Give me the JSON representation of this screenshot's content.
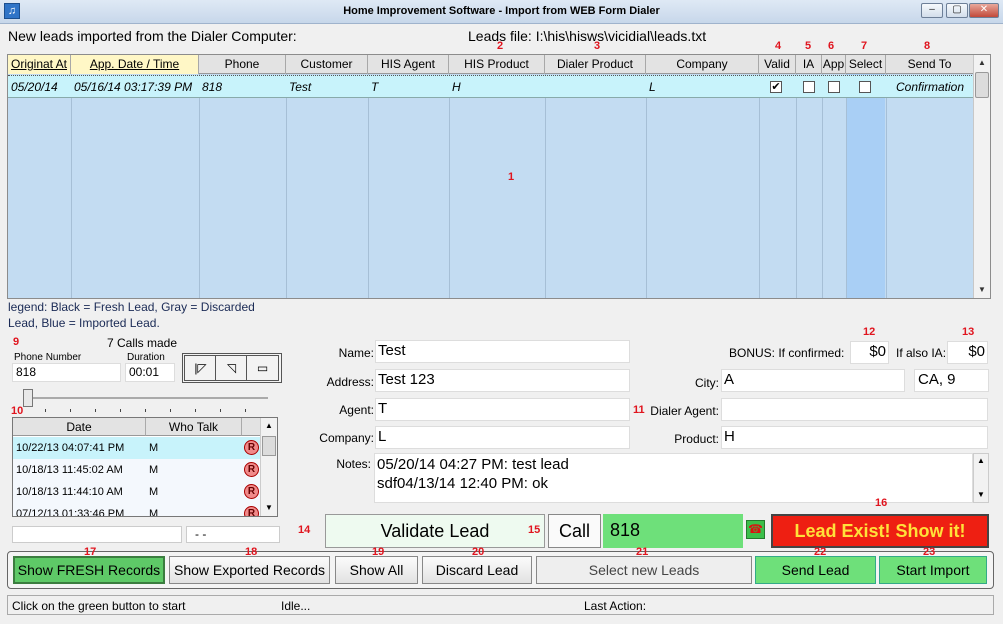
{
  "window": {
    "title": "Home Improvement Software - Import from WEB Form Dialer",
    "min": "–",
    "max": "▢",
    "close": "✕"
  },
  "header": {
    "new_leads": "New leads imported from the Dialer Computer:",
    "leads_file": "Leads file: I:\\his\\hisws\\vicidial\\leads.txt"
  },
  "markers": {
    "m1": "1",
    "m2": "2",
    "m3": "3",
    "m4": "4",
    "m5": "5",
    "m6": "6",
    "m7": "7",
    "m8": "8",
    "m9": "9",
    "m10": "10",
    "m11": "11",
    "m12": "12",
    "m13": "13",
    "m14": "14",
    "m15": "15",
    "m16": "16",
    "m17": "17",
    "m18": "18",
    "m19": "19",
    "m20": "20",
    "m21": "21",
    "m22": "22",
    "m23": "23"
  },
  "grid": {
    "columns": [
      "Originat At",
      "App. Date / Time",
      "Phone",
      "Customer",
      "HIS Agent",
      "HIS Product",
      "Dialer Product",
      "Company",
      "Valid",
      "IA",
      "App",
      "Select",
      "Send To"
    ],
    "row": {
      "originat_at": "05/20/14",
      "app_date_time": "05/16/14 03:17:39 PM",
      "phone": "818",
      "customer": "Test",
      "his_agent": "T",
      "his_product": "H",
      "dialer_product": "",
      "company": "L",
      "valid": "✔",
      "ia": "",
      "app": "",
      "select": "",
      "send_to": "Confirmation"
    }
  },
  "legend": {
    "line1": "legend: Black = Fresh Lead, Gray = Discarded",
    "line2": "Lead, Blue = Imported Lead."
  },
  "phone_panel": {
    "calls_made": "7 Calls made",
    "phone_label": "Phone Number",
    "phone_value": "818",
    "duration_label": "Duration",
    "duration_value": "00:01",
    "nav": [
      "|◸",
      "◹",
      "▭"
    ]
  },
  "calls_list": {
    "headers": [
      "Date",
      "Who Talk"
    ],
    "rows": [
      {
        "date": "10/22/13 04:07:41 PM",
        "who": "M",
        "badge": "R"
      },
      {
        "date": "10/18/13 11:45:02 AM",
        "who": "M",
        "badge": "R"
      },
      {
        "date": "10/18/13 11:44:10 AM",
        "who": "M",
        "badge": "R"
      },
      {
        "date": "07/12/13 01:33:46 PM",
        "who": "M",
        "badge": "R"
      }
    ],
    "footer_right": "- -"
  },
  "details": {
    "name_label": "Name:",
    "name": "Test",
    "address_label": "Address:",
    "address": "Test 123",
    "agent_label": "Agent:",
    "agent": "T",
    "company_label": "Company:",
    "company": "L",
    "notes_label": "Notes:",
    "notes_line1": "05/20/14 04:27 PM: test lead",
    "notes_line2": "sdf04/13/14 12:40 PM: ok",
    "bonus_label": "BONUS: If confirmed:",
    "bonus_value": "$0",
    "ia_label": "If also IA:",
    "ia_value": "$0",
    "city_label": "City:",
    "city": "A",
    "state": "CA, 9",
    "dialer_agent_label": "Dialer Agent:",
    "dialer_agent": "",
    "product_label": "Product:",
    "product": "H"
  },
  "actions": {
    "validate": "Validate Lead",
    "call": "Call",
    "call_number": "818",
    "lead_exist": "Lead Exist! Show it!"
  },
  "toolbar": {
    "fresh": "Show FRESH Records",
    "exported": "Show Exported Records",
    "all": "Show All",
    "discard": "Discard Lead",
    "select_new": "Select new Leads",
    "send": "Send Lead",
    "start_import": "Start Import"
  },
  "status": {
    "hint": "Click on the green button to start",
    "state": "Idle...",
    "last_action": "Last Action:"
  },
  "colors": {
    "selected_row": "#c8f3fb",
    "grid_bg": "#c3dcf2",
    "green_button": "#6ee07a",
    "lead_exist_red": "#ee1f12",
    "marker_red": "#e0141e"
  }
}
